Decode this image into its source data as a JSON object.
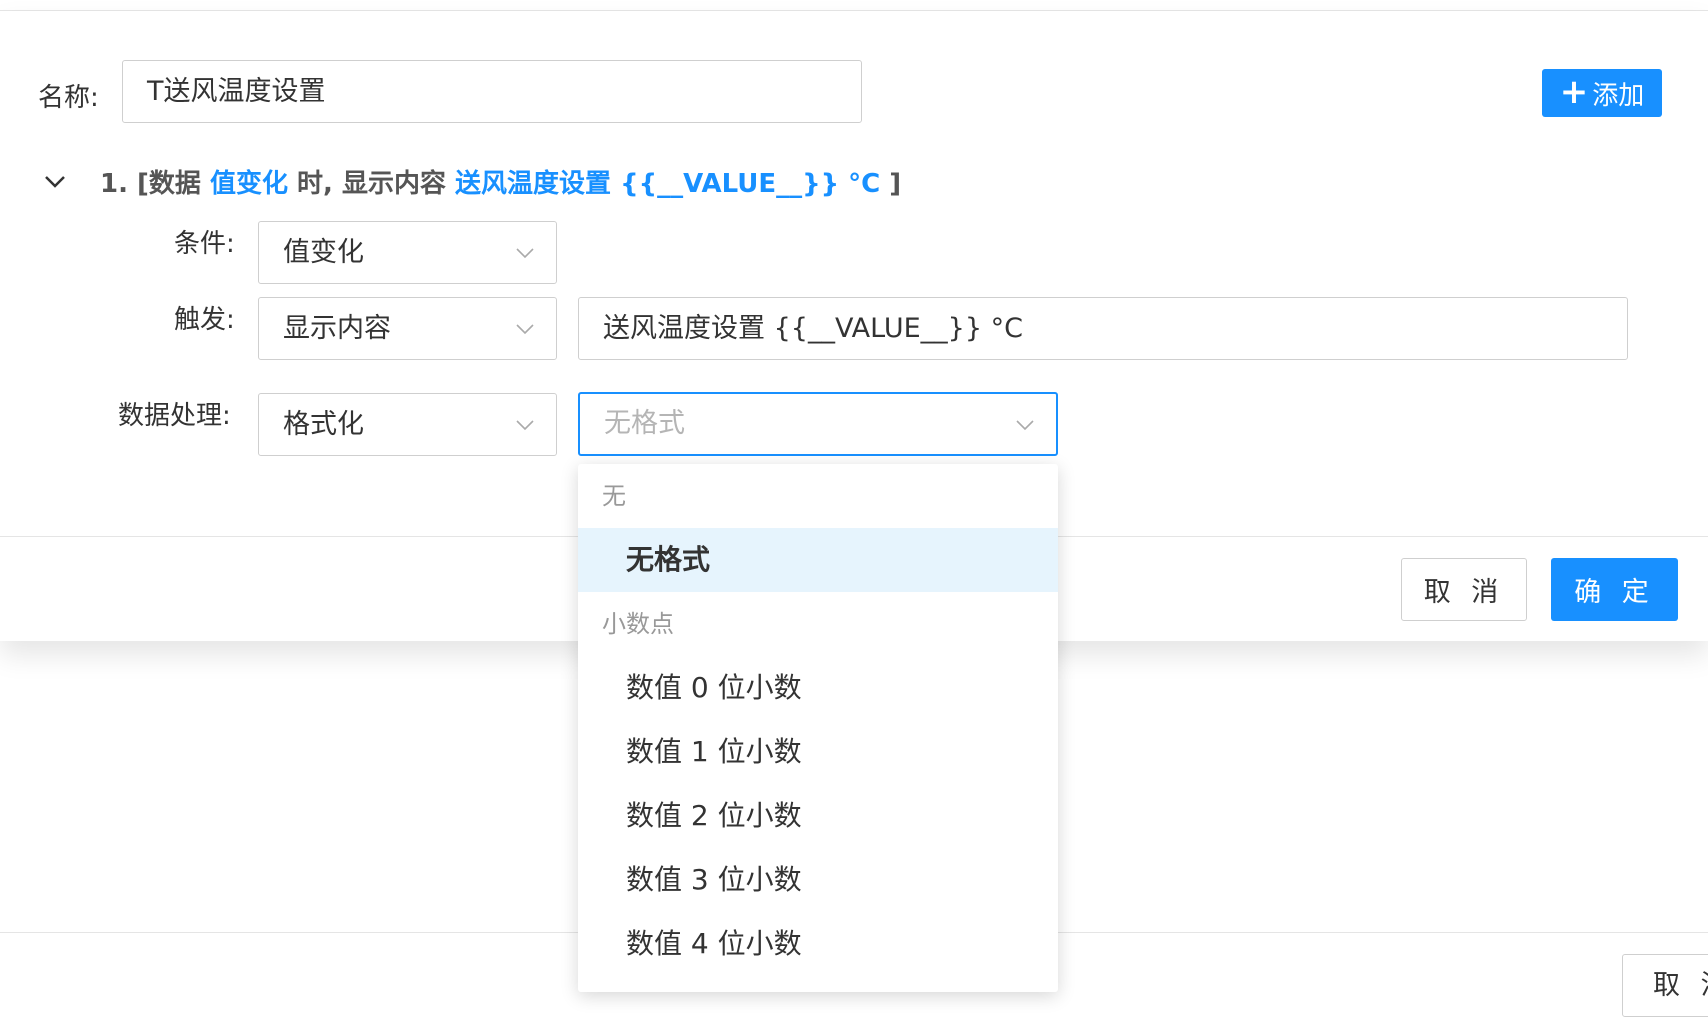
{
  "form": {
    "name_label": "名称:",
    "name_value": "T送风温度设置",
    "add_button": "添加"
  },
  "rule": {
    "index": "1. [数据 ",
    "condition_hl": "值变化",
    "mid": " 时, 显示内容 ",
    "content_hl": "送风温度设置 {{__VALUE__}} °C",
    "end": " ]",
    "condition_label": "条件:",
    "condition_value": "值变化",
    "trigger_label": "触发:",
    "trigger_value": "显示内容",
    "trigger_content": "送风温度设置 {{__VALUE__}} °C",
    "processing_label": "数据处理:",
    "processing_value": "格式化",
    "format_placeholder": "无格式"
  },
  "modal_footer": {
    "cancel": "取 消",
    "confirm": "确 定"
  },
  "lower_footer": {
    "cancel": "取 消"
  },
  "dropdown": {
    "group_none": "无",
    "option_none": "无格式",
    "group_decimal": "小数点",
    "options": [
      "数值 0 位小数",
      "数值 1 位小数",
      "数值 2 位小数",
      "数值 3 位小数",
      "数值 4 位小数"
    ]
  },
  "colors": {
    "accent": "#1890ff",
    "selected_bg": "#e6f4fd"
  }
}
